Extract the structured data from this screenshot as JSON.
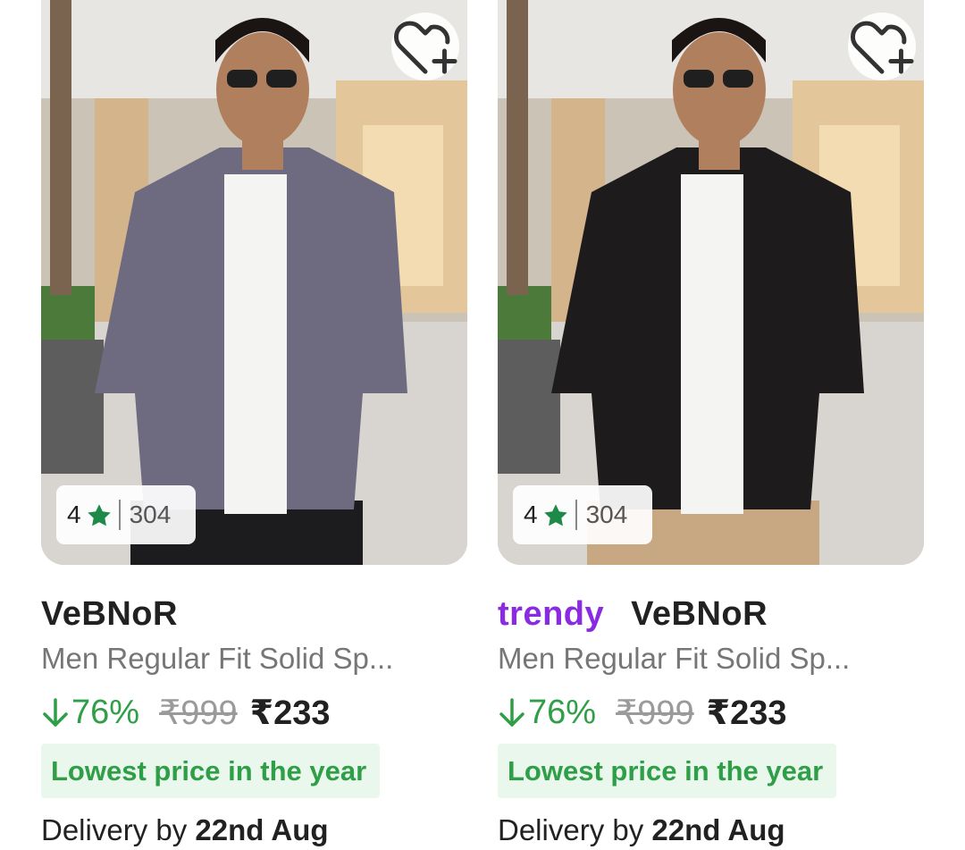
{
  "products": [
    {
      "rating": "4",
      "rating_count": "304",
      "ad_tag": "",
      "brand": "VeBNoR",
      "title": "Men Regular Fit Solid Sp...",
      "discount": "76%",
      "mrp": "₹999",
      "price": "₹233",
      "badge": "Lowest price in the year",
      "delivery_prefix": "Delivery by ",
      "delivery_date": "22nd Aug",
      "shirt_color": "#6e6b80",
      "pants_color": "#1c1c1f"
    },
    {
      "rating": "4",
      "rating_count": "304",
      "ad_tag": "trendy",
      "brand": "VeBNoR",
      "title": "Men Regular Fit Solid Sp...",
      "discount": "76%",
      "mrp": "₹999",
      "price": "₹233",
      "badge": "Lowest price in the year",
      "delivery_prefix": "Delivery by ",
      "delivery_date": "22nd Aug",
      "shirt_color": "#1e1b1d",
      "pants_color": "#c7a882"
    }
  ],
  "colors": {
    "discount_green": "#2e9e47",
    "badge_bg": "#e9f7ec",
    "trendy_purple": "#8a2be2",
    "star_green": "#1e8a4a"
  },
  "icons": {
    "wishlist": "heart-plus-icon",
    "star": "star-icon",
    "discount": "arrow-down-icon"
  }
}
